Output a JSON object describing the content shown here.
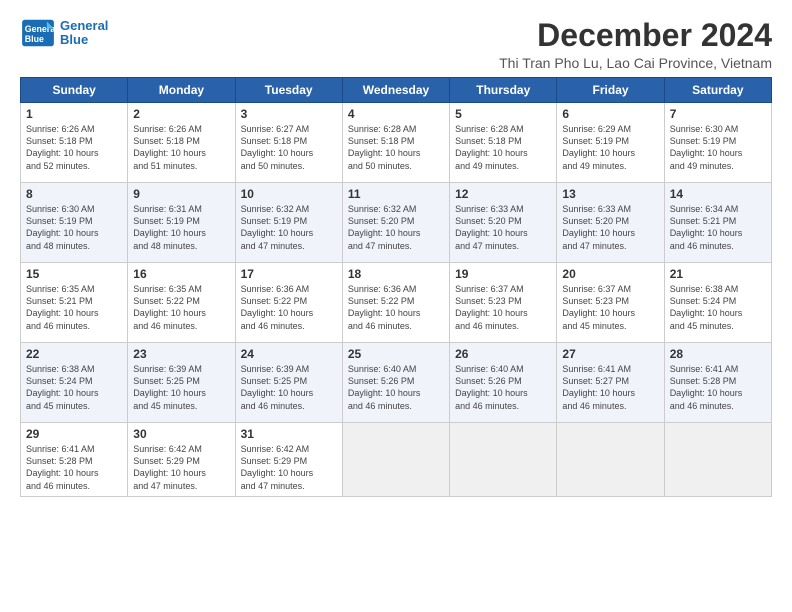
{
  "header": {
    "logo_line1": "General",
    "logo_line2": "Blue",
    "month": "December 2024",
    "location": "Thi Tran Pho Lu, Lao Cai Province, Vietnam"
  },
  "days_of_week": [
    "Sunday",
    "Monday",
    "Tuesday",
    "Wednesday",
    "Thursday",
    "Friday",
    "Saturday"
  ],
  "weeks": [
    [
      {
        "day": "1",
        "info": "Sunrise: 6:26 AM\nSunset: 5:18 PM\nDaylight: 10 hours\nand 52 minutes."
      },
      {
        "day": "2",
        "info": "Sunrise: 6:26 AM\nSunset: 5:18 PM\nDaylight: 10 hours\nand 51 minutes."
      },
      {
        "day": "3",
        "info": "Sunrise: 6:27 AM\nSunset: 5:18 PM\nDaylight: 10 hours\nand 50 minutes."
      },
      {
        "day": "4",
        "info": "Sunrise: 6:28 AM\nSunset: 5:18 PM\nDaylight: 10 hours\nand 50 minutes."
      },
      {
        "day": "5",
        "info": "Sunrise: 6:28 AM\nSunset: 5:18 PM\nDaylight: 10 hours\nand 49 minutes."
      },
      {
        "day": "6",
        "info": "Sunrise: 6:29 AM\nSunset: 5:19 PM\nDaylight: 10 hours\nand 49 minutes."
      },
      {
        "day": "7",
        "info": "Sunrise: 6:30 AM\nSunset: 5:19 PM\nDaylight: 10 hours\nand 49 minutes."
      }
    ],
    [
      {
        "day": "8",
        "info": "Sunrise: 6:30 AM\nSunset: 5:19 PM\nDaylight: 10 hours\nand 48 minutes."
      },
      {
        "day": "9",
        "info": "Sunrise: 6:31 AM\nSunset: 5:19 PM\nDaylight: 10 hours\nand 48 minutes."
      },
      {
        "day": "10",
        "info": "Sunrise: 6:32 AM\nSunset: 5:19 PM\nDaylight: 10 hours\nand 47 minutes."
      },
      {
        "day": "11",
        "info": "Sunrise: 6:32 AM\nSunset: 5:20 PM\nDaylight: 10 hours\nand 47 minutes."
      },
      {
        "day": "12",
        "info": "Sunrise: 6:33 AM\nSunset: 5:20 PM\nDaylight: 10 hours\nand 47 minutes."
      },
      {
        "day": "13",
        "info": "Sunrise: 6:33 AM\nSunset: 5:20 PM\nDaylight: 10 hours\nand 47 minutes."
      },
      {
        "day": "14",
        "info": "Sunrise: 6:34 AM\nSunset: 5:21 PM\nDaylight: 10 hours\nand 46 minutes."
      }
    ],
    [
      {
        "day": "15",
        "info": "Sunrise: 6:35 AM\nSunset: 5:21 PM\nDaylight: 10 hours\nand 46 minutes."
      },
      {
        "day": "16",
        "info": "Sunrise: 6:35 AM\nSunset: 5:22 PM\nDaylight: 10 hours\nand 46 minutes."
      },
      {
        "day": "17",
        "info": "Sunrise: 6:36 AM\nSunset: 5:22 PM\nDaylight: 10 hours\nand 46 minutes."
      },
      {
        "day": "18",
        "info": "Sunrise: 6:36 AM\nSunset: 5:22 PM\nDaylight: 10 hours\nand 46 minutes."
      },
      {
        "day": "19",
        "info": "Sunrise: 6:37 AM\nSunset: 5:23 PM\nDaylight: 10 hours\nand 46 minutes."
      },
      {
        "day": "20",
        "info": "Sunrise: 6:37 AM\nSunset: 5:23 PM\nDaylight: 10 hours\nand 45 minutes."
      },
      {
        "day": "21",
        "info": "Sunrise: 6:38 AM\nSunset: 5:24 PM\nDaylight: 10 hours\nand 45 minutes."
      }
    ],
    [
      {
        "day": "22",
        "info": "Sunrise: 6:38 AM\nSunset: 5:24 PM\nDaylight: 10 hours\nand 45 minutes."
      },
      {
        "day": "23",
        "info": "Sunrise: 6:39 AM\nSunset: 5:25 PM\nDaylight: 10 hours\nand 45 minutes."
      },
      {
        "day": "24",
        "info": "Sunrise: 6:39 AM\nSunset: 5:25 PM\nDaylight: 10 hours\nand 46 minutes."
      },
      {
        "day": "25",
        "info": "Sunrise: 6:40 AM\nSunset: 5:26 PM\nDaylight: 10 hours\nand 46 minutes."
      },
      {
        "day": "26",
        "info": "Sunrise: 6:40 AM\nSunset: 5:26 PM\nDaylight: 10 hours\nand 46 minutes."
      },
      {
        "day": "27",
        "info": "Sunrise: 6:41 AM\nSunset: 5:27 PM\nDaylight: 10 hours\nand 46 minutes."
      },
      {
        "day": "28",
        "info": "Sunrise: 6:41 AM\nSunset: 5:28 PM\nDaylight: 10 hours\nand 46 minutes."
      }
    ],
    [
      {
        "day": "29",
        "info": "Sunrise: 6:41 AM\nSunset: 5:28 PM\nDaylight: 10 hours\nand 46 minutes."
      },
      {
        "day": "30",
        "info": "Sunrise: 6:42 AM\nSunset: 5:29 PM\nDaylight: 10 hours\nand 47 minutes."
      },
      {
        "day": "31",
        "info": "Sunrise: 6:42 AM\nSunset: 5:29 PM\nDaylight: 10 hours\nand 47 minutes."
      },
      {
        "day": "",
        "info": ""
      },
      {
        "day": "",
        "info": ""
      },
      {
        "day": "",
        "info": ""
      },
      {
        "day": "",
        "info": ""
      }
    ]
  ]
}
